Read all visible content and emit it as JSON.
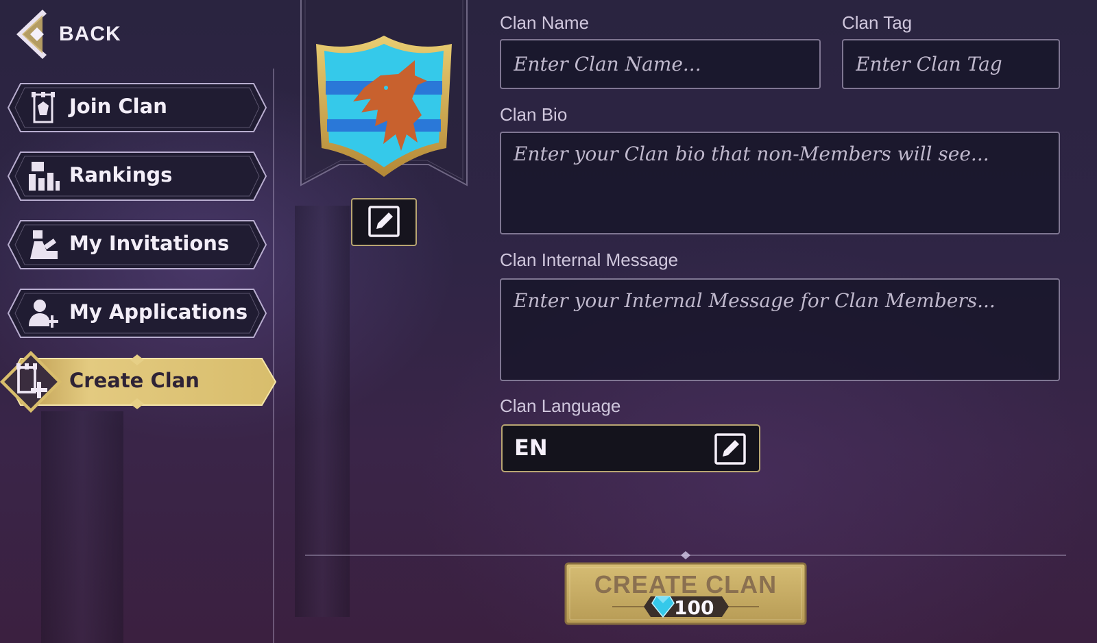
{
  "nav": {
    "back_label": "BACK"
  },
  "sidebar": {
    "items": [
      {
        "label": "Join Clan",
        "icon": "tower-icon",
        "active": false
      },
      {
        "label": "Rankings",
        "icon": "rankings-icon",
        "active": false
      },
      {
        "label": "My Invitations",
        "icon": "invitations-icon",
        "active": false
      },
      {
        "label": "My Applications",
        "icon": "add-user-icon",
        "active": false
      },
      {
        "label": "Create Clan",
        "icon": "create-clan-icon",
        "active": true
      }
    ]
  },
  "crest": {
    "icon": "dragon-crest-icon",
    "edit_icon": "edit-icon"
  },
  "form": {
    "clan_name": {
      "label": "Clan Name",
      "placeholder": "Enter Clan Name...",
      "value": ""
    },
    "clan_tag": {
      "label": "Clan Tag",
      "placeholder": "Enter Clan Tag",
      "value": ""
    },
    "clan_bio": {
      "label": "Clan Bio",
      "placeholder": "Enter your Clan bio that non-Members will see...",
      "value": ""
    },
    "clan_internal_message": {
      "label": "Clan Internal Message",
      "placeholder": "Enter your Internal Message for Clan Members...",
      "value": ""
    },
    "clan_language": {
      "label": "Clan Language",
      "value": "EN",
      "edit_icon": "edit-icon"
    }
  },
  "create_button": {
    "label": "CREATE CLAN",
    "cost": "100",
    "currency_icon": "gem-icon"
  },
  "colors": {
    "gold": "#d9bd6a",
    "gold_dark": "#a88840",
    "crest_blue": "#35c9ea",
    "dragon": "#c8612e"
  }
}
